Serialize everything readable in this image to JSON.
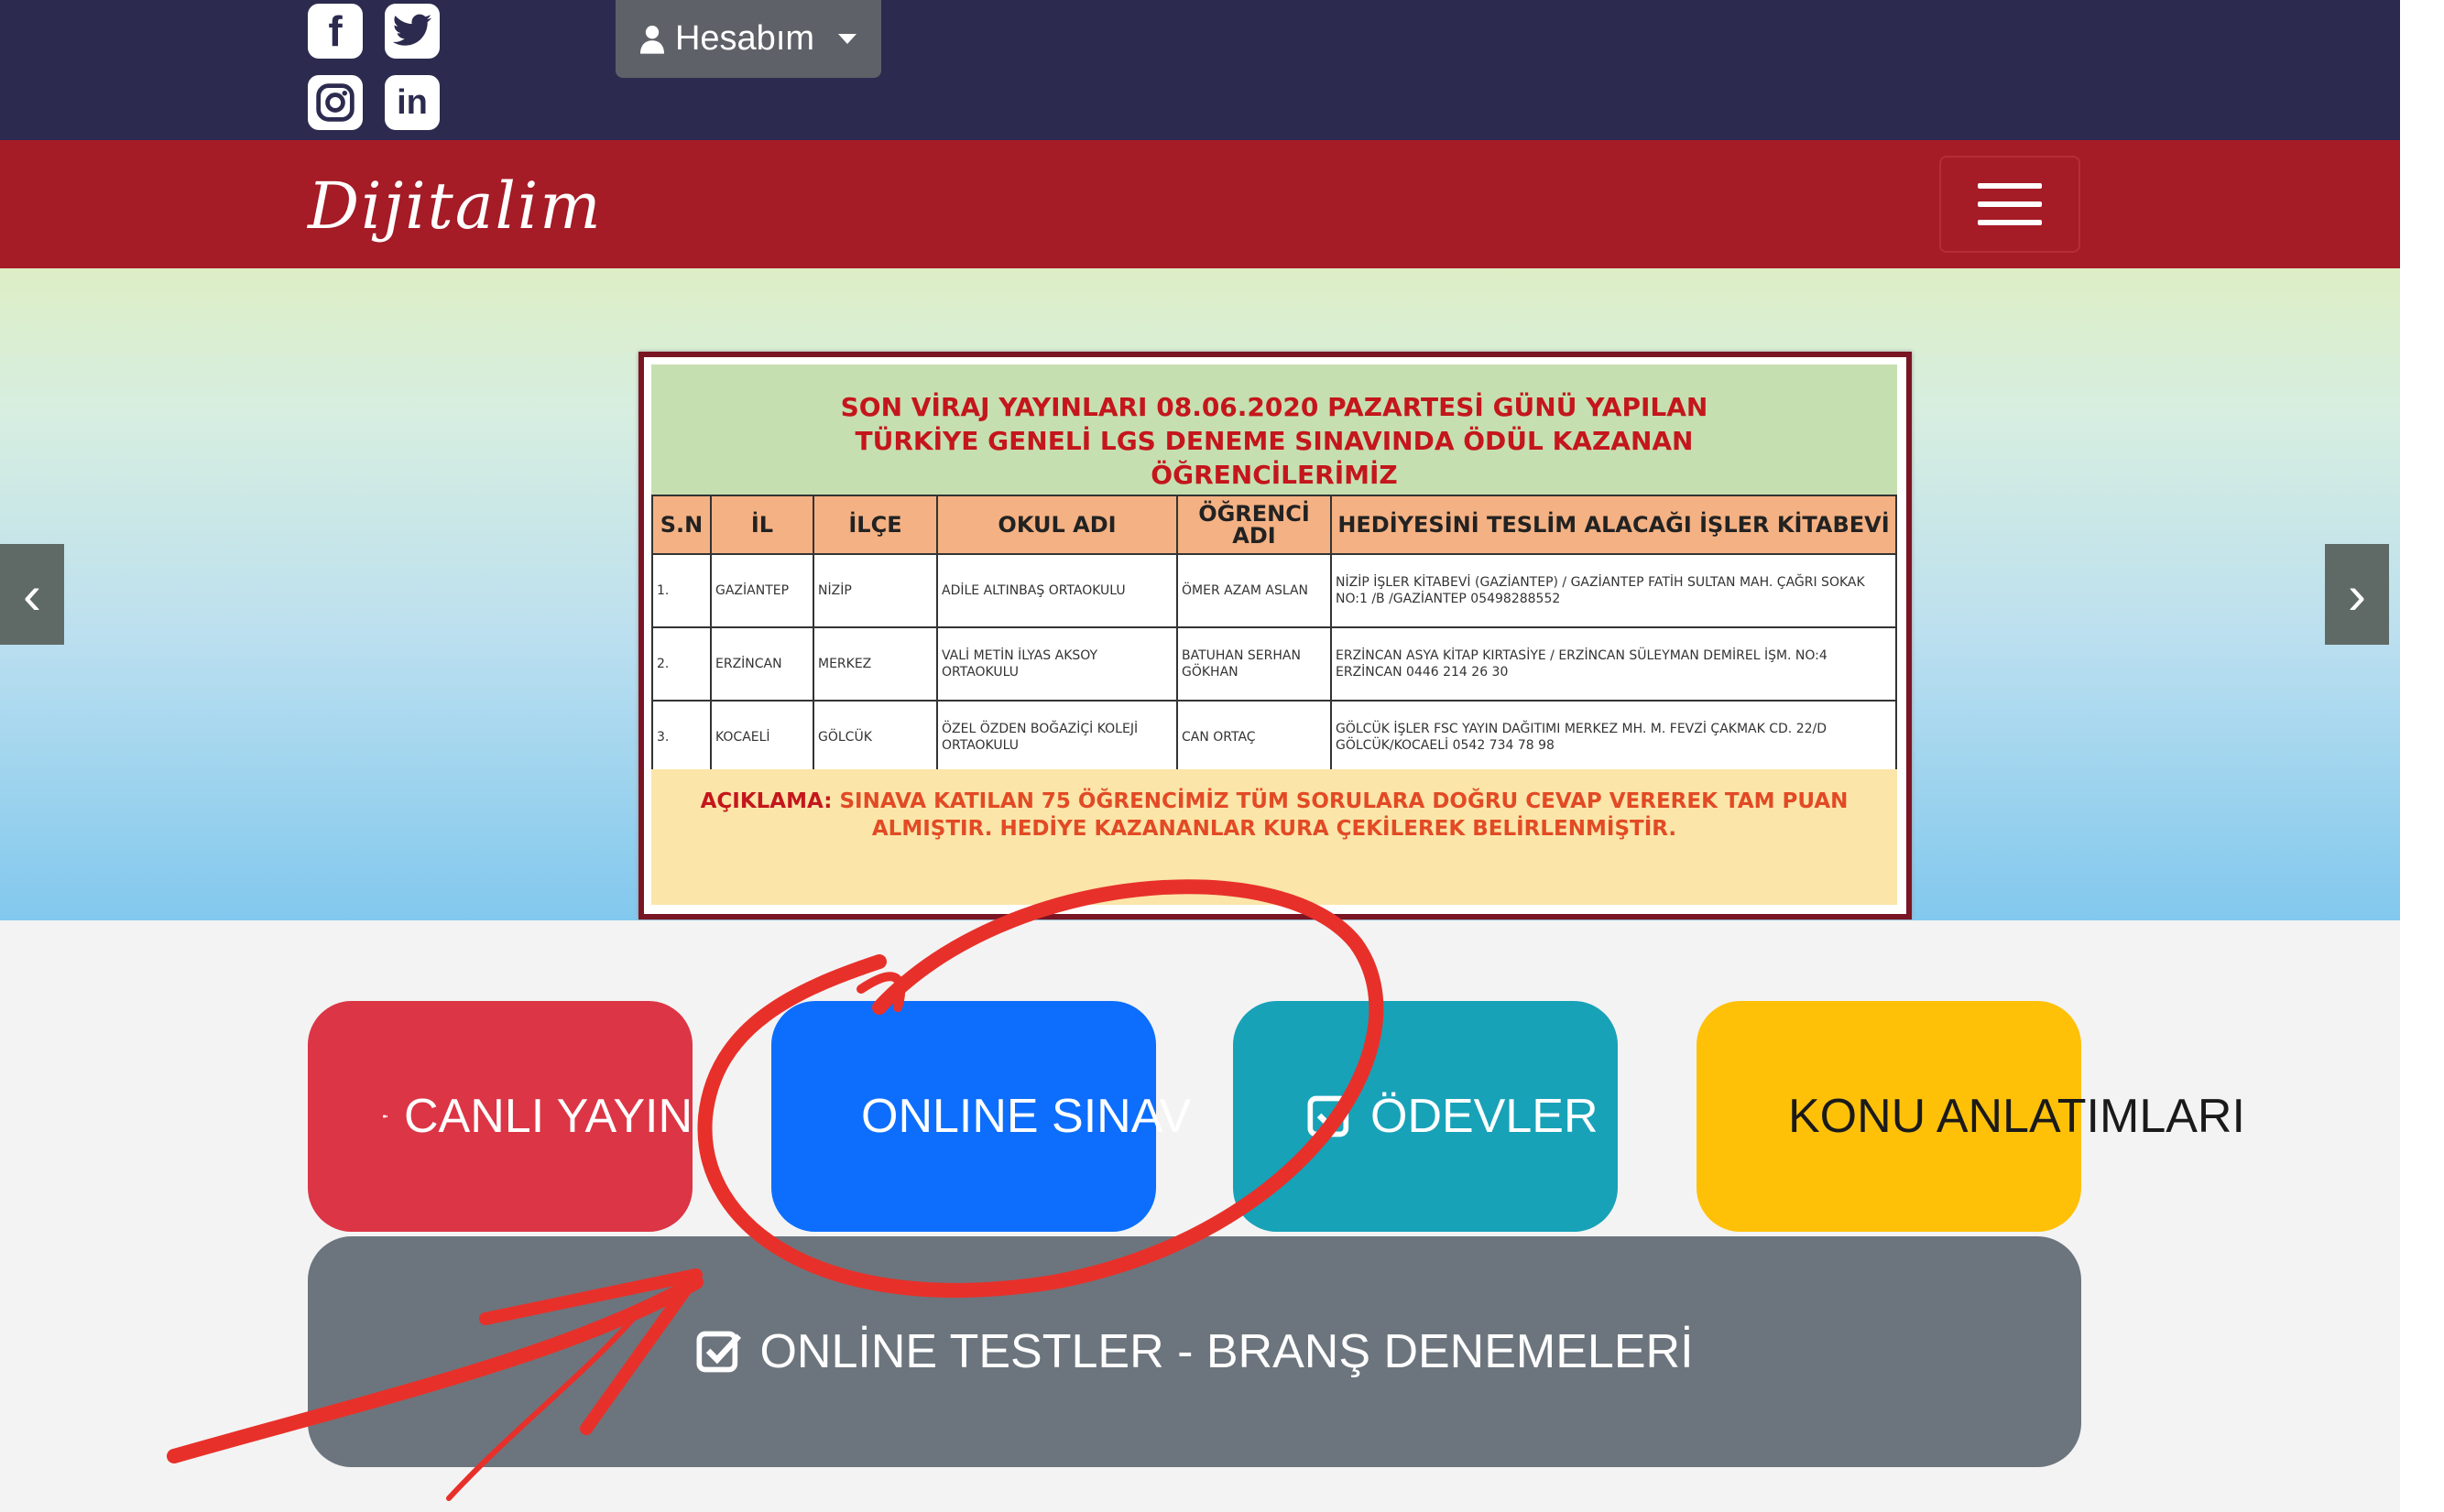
{
  "header": {
    "account_label": "Hesabım",
    "social": [
      {
        "name": "facebook-icon",
        "glyph": "f"
      },
      {
        "name": "twitter-icon",
        "glyph": "t"
      },
      {
        "name": "instagram-icon",
        "glyph": "◎"
      },
      {
        "name": "linkedin-icon",
        "glyph": "in"
      }
    ]
  },
  "navbar": {
    "brand": "Dijitalim"
  },
  "slider": {
    "prev_glyph": "‹",
    "next_glyph": "›",
    "poster": {
      "title_lines": [
        "SON VİRAJ YAYINLARI 08.06.2020 PAZARTESİ GÜNÜ YAPILAN",
        "TÜRKİYE GENELİ LGS DENEME SINAVINDA ÖDÜL KAZANAN",
        "ÖĞRENCİLERİMİZ"
      ],
      "columns": [
        "S.N",
        "İL",
        "İLÇE",
        "OKUL ADI",
        "ÖĞRENCİ ADI",
        "HEDİYESİNİ TESLİM ALACAĞI İŞLER KİTABEVİ"
      ],
      "rows": [
        [
          "1.",
          "GAZİANTEP",
          "NİZİP",
          "ADİLE ALTINBAŞ ORTAOKULU",
          "ÖMER AZAM ASLAN",
          "NİZİP İŞLER KİTABEVİ (GAZİANTEP) / GAZİANTEP FATİH SULTAN MAH. ÇAĞRI SOKAK NO:1 /B /GAZİANTEP 05498288552"
        ],
        [
          "2.",
          "ERZİNCAN",
          "MERKEZ",
          "VALİ METİN İLYAS AKSOY ORTAOKULU",
          "BATUHAN SERHAN GÖKHAN",
          "ERZİNCAN ASYA KİTAP KIRTASİYE / ERZİNCAN SÜLEYMAN DEMİREL İŞM. NO:4 ERZİNCAN 0446 214 26 30"
        ],
        [
          "3.",
          "KOCAELİ",
          "GÖLCÜK",
          "ÖZEL ÖZDEN BOĞAZİÇİ KOLEJİ ORTAOKULU",
          "CAN ORTAÇ",
          "GÖLCÜK İŞLER FSC YAYIN DAĞITIMI MERKEZ MH. M. FEVZİ ÇAKMAK CD. 22/D GÖLCÜK/KOCAELİ 0542 734 78 98"
        ]
      ],
      "note_label": "AÇIKLAMA:",
      "note_text": "SINAVA KATILAN 75 ÖĞRENCİMİZ TÜM SORULARA DOĞRU CEVAP VEREREK TAM PUAN ALMIŞTIR. HEDİYE KAZANANLAR KURA ÇEKİLEREK BELİRLENMİŞTİR."
    }
  },
  "actions": {
    "live": {
      "label": "CANLI YAYIN",
      "icon": "video-camera-icon",
      "color": "#dc3545"
    },
    "exam": {
      "label": "ONLINE SINAV",
      "icon": "checkbox-icon",
      "color": "#0d6efd"
    },
    "homework": {
      "label": "ÖDEVLER",
      "icon": "checkbox-icon",
      "color": "#17a2b8"
    },
    "topics": {
      "label": "KONU ANLATIMLARI",
      "icon": "presentation-icon",
      "color": "#ffc107"
    },
    "tests": {
      "label": "ONLİNE TESTLER - BRANŞ DENEMELERİ",
      "icon": "checkbox-icon",
      "color": "#6c757d"
    }
  },
  "annotation": {
    "color": "#e8302a"
  }
}
